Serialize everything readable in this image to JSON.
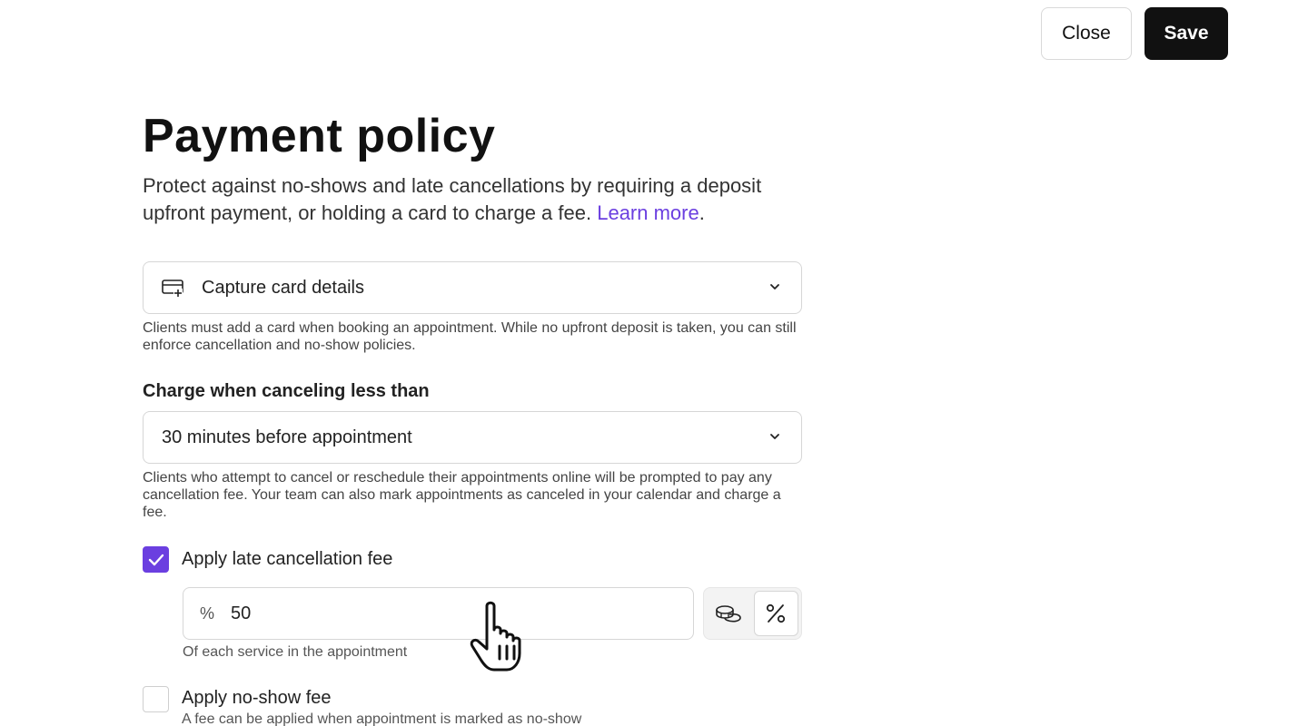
{
  "header": {
    "close_label": "Close",
    "save_label": "Save"
  },
  "page": {
    "title": "Payment policy",
    "intro": "Protect against no-shows and late cancellations by requiring a deposit upfront payment, or holding a card to charge a fee.",
    "learn_more": "Learn more",
    "learn_more_suffix": "."
  },
  "capture": {
    "label": "Capture card details",
    "icon": "card-plus-icon",
    "help": "Clients must add a card when booking an appointment. While no upfront deposit is taken, you can still enforce cancellation and no-show policies."
  },
  "cancel_window": {
    "label": "Charge when canceling less than",
    "value": "30 minutes before appointment",
    "help": "Clients who attempt to cancel or reschedule their appointments online will be prompted to pay any cancellation fee. Your team can also mark appointments as canceled in your calendar and charge a fee."
  },
  "late_fee": {
    "checked": true,
    "label": "Apply late cancellation fee",
    "unit": "%",
    "value": "50",
    "help": "Of each service in the appointment",
    "mode_options": [
      "coins-icon",
      "percent-icon"
    ],
    "active_mode": "percent-icon"
  },
  "no_show": {
    "checked": false,
    "label": "Apply no-show fee",
    "help": "A fee can be applied when appointment is marked as no-show"
  },
  "colors": {
    "accent": "#6b3fe0",
    "primary_button": "#111111"
  }
}
